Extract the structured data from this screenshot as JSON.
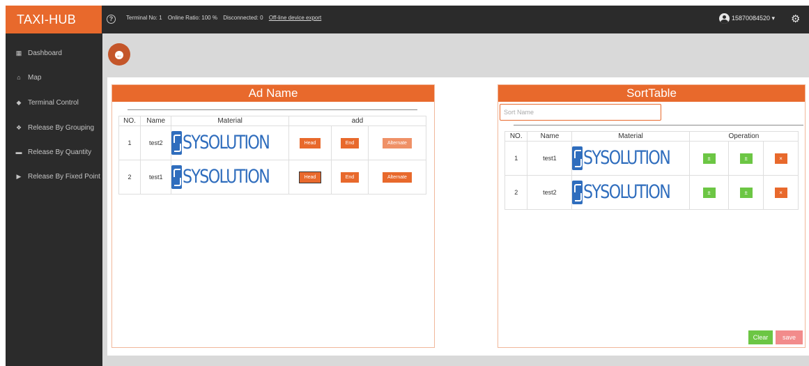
{
  "header": {
    "brand": "TAXI-HUB",
    "terminal_no": "Terminal No: 1",
    "online_ratio": "Online Ratio: 100 %",
    "disconnected": "Disconnected: 0",
    "export_link": "Off-line device export",
    "user_phone": "15870084520 ▾",
    "help_glyph": "?",
    "gear_glyph": "⚙"
  },
  "sidebar": {
    "items": [
      {
        "label": "Dashboard",
        "icon": "▦"
      },
      {
        "label": "Map",
        "icon": "⌂"
      },
      {
        "label": "Terminal Control",
        "icon": "◆"
      },
      {
        "label": "Release By Grouping",
        "icon": "❖"
      },
      {
        "label": "Release By Quantity",
        "icon": "▬"
      },
      {
        "label": "Release By Fixed Point",
        "icon": "▶"
      }
    ]
  },
  "back_button": {
    "glyph": "←"
  },
  "ad_panel": {
    "title": "Ad Name",
    "columns": [
      "NO.",
      "Name",
      "Material",
      "add"
    ],
    "rows": [
      {
        "no": "1",
        "name": "test2",
        "logo": "SYSOLUTION",
        "head": "Head",
        "end": "End",
        "alternate": "Alternate"
      },
      {
        "no": "2",
        "name": "test1",
        "logo": "SYSOLUTION",
        "head": "Head",
        "end": "End",
        "alternate": "Alternate"
      }
    ]
  },
  "sort_panel": {
    "title": "SortTable",
    "search_placeholder": "Sort Name",
    "columns": [
      "NO.",
      "Name",
      "Material",
      "Operation"
    ],
    "rows": [
      {
        "no": "1",
        "name": "test1",
        "logo": "SYSOLUTION",
        "up": "±",
        "down": "±",
        "remove": "×"
      },
      {
        "no": "2",
        "name": "test2",
        "logo": "SYSOLUTION",
        "up": "±",
        "down": "±",
        "remove": "×"
      }
    ],
    "clear_label": "Clear",
    "save_label": "save"
  },
  "colors": {
    "accent": "#e8692c",
    "topbar": "#2b2b2b",
    "green": "#6cc644",
    "save": "#f28b8b",
    "logo_blue": "#2f6dbd"
  }
}
